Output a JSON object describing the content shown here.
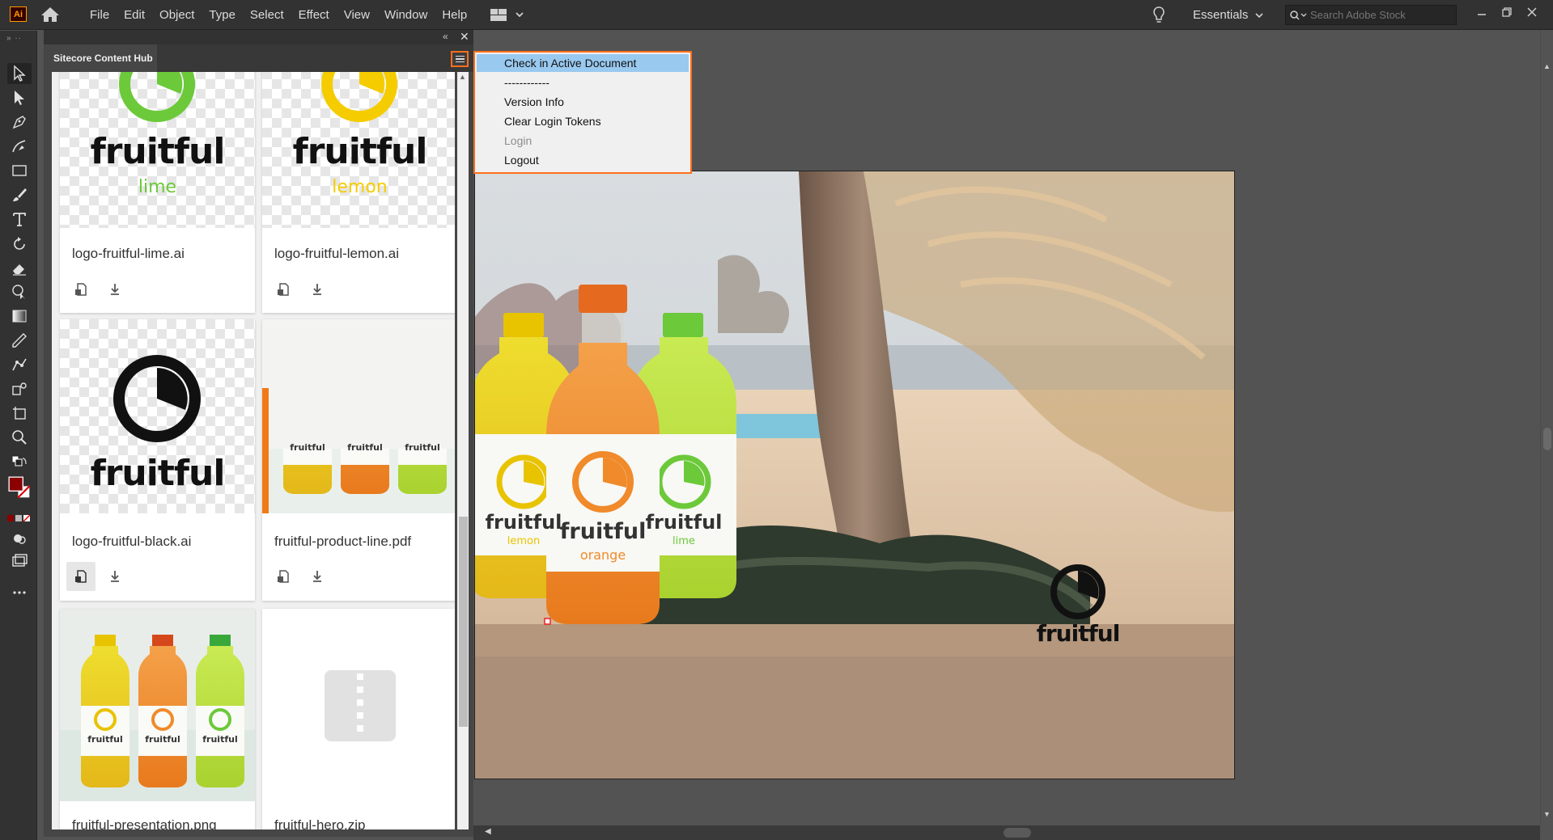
{
  "app": {
    "logo_text": "Ai",
    "menu": [
      "File",
      "Edit",
      "Object",
      "Type",
      "Select",
      "Effect",
      "View",
      "Window",
      "Help"
    ],
    "workspace": "Essentials",
    "stock_search_placeholder": "Search Adobe Stock"
  },
  "panel": {
    "title": "Sitecore Content Hub",
    "assets": [
      {
        "name": "logo-fruitful-lime.ai",
        "logo_word": "fruitful",
        "logo_sub": "lime",
        "color": "#6cc93a"
      },
      {
        "name": "logo-fruitful-lemon.ai",
        "logo_word": "fruitful",
        "logo_sub": "lemon",
        "color": "#f5cc00"
      },
      {
        "name": "logo-fruitful-black.ai",
        "logo_word": "fruitful",
        "color": "#111111"
      },
      {
        "name": "fruitful-product-line.pdf",
        "labels": [
          "fruitful",
          "fruitful",
          "fruitful"
        ]
      },
      {
        "name": "fruitful-presentation.png",
        "labels": [
          "fruitful",
          "fruitful",
          "fruitful"
        ]
      },
      {
        "name": "fruitful-hero.zip"
      }
    ]
  },
  "dropdown": {
    "items": [
      "Check in Active Document",
      "------------",
      "Version Info",
      "Clear Login Tokens",
      "Login",
      "Logout"
    ]
  },
  "artboard": {
    "bottles": [
      {
        "word": "fruitful",
        "sub": "lemon",
        "color": "#e8c300"
      },
      {
        "word": "fruitful",
        "sub": "orange",
        "color": "#f08a2a"
      },
      {
        "word": "fruitful",
        "sub": "lime",
        "color": "#6cc93a"
      }
    ],
    "corner_logo": "fruitful"
  },
  "colors": {
    "accent_orange": "#ff6f1c",
    "menu_highlight": "#99c9ef",
    "fill_swatch": "#8b0000"
  }
}
